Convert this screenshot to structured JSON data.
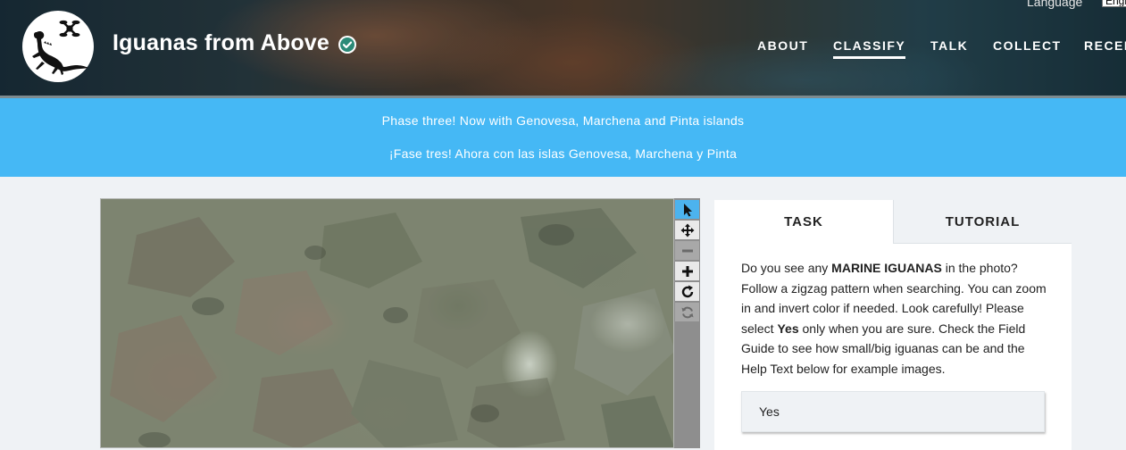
{
  "header": {
    "project_title": "Iguanas from Above",
    "language_label": "Language",
    "language_value": "Engl",
    "nav": [
      {
        "label": "ABOUT",
        "active": false
      },
      {
        "label": "CLASSIFY",
        "active": true
      },
      {
        "label": "TALK",
        "active": false
      },
      {
        "label": "COLLECT",
        "active": false
      },
      {
        "label": "RECEN",
        "active": false
      }
    ]
  },
  "banner": {
    "line_en": "Phase three! Now with Genovesa, Marchena and Pinta islands",
    "line_es": "¡Fase tres! Ahora con las islas Genovesa, Marchena y Pinta"
  },
  "toolbar": {
    "tools": [
      {
        "icon": "pointer-icon",
        "state": "active"
      },
      {
        "icon": "move-icon",
        "state": "normal"
      },
      {
        "icon": "zoom-out-icon",
        "state": "disabled"
      },
      {
        "icon": "zoom-in-icon",
        "state": "normal"
      },
      {
        "icon": "rotate-icon",
        "state": "normal"
      },
      {
        "icon": "reset-icon",
        "state": "disabled"
      }
    ]
  },
  "panel": {
    "tabs": [
      {
        "label": "TASK",
        "active": true
      },
      {
        "label": "TUTORIAL",
        "active": false
      }
    ],
    "instructions": {
      "p1": "Do you see any ",
      "b1": "MARINE IGUANAS",
      "p2": " in the photo? Follow a zigzag pattern when searching. You can zoom in and invert color if needed. Look carefully! Please select ",
      "b2": "Yes",
      "p3": " only when you are sure. Check the Field Guide to see how small/big iguanas can be and the Help Text below for example images."
    },
    "answers": [
      {
        "label": "Yes"
      }
    ]
  },
  "colors": {
    "banner": "#45b8f5",
    "active_tool": "#4cb3ee",
    "page_background": "#eff2f5",
    "verified_badge": "#2b8a78"
  }
}
